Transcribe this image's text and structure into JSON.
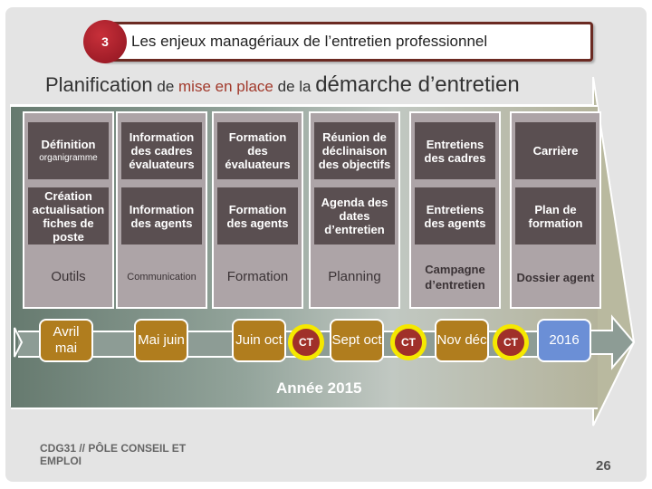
{
  "header": {
    "section_number": "3",
    "section_title": "Les enjeux managériaux de l’entretien professionnel"
  },
  "title": {
    "part1": "Planification",
    "part2": " de ",
    "part3": "mise en place",
    "part4": " de la ",
    "part5": "démarche d’entretien"
  },
  "columns": [
    {
      "cell1_main": "Définition",
      "cell1_sub": "organigramme",
      "cell2": "Création actualisation fiches de poste",
      "footer": "Outils"
    },
    {
      "cell1_main": "Information des cadres évaluateurs",
      "cell1_sub": "",
      "cell2": "Information des agents",
      "footer": "Communication"
    },
    {
      "cell1_main": "Formation des évaluateurs",
      "cell1_sub": "",
      "cell2": "Formation des agents",
      "footer": "Formation"
    },
    {
      "cell1_main": "Réunion de déclinaison des objectifs",
      "cell1_sub": "",
      "cell2": "Agenda des dates d’entretien",
      "footer": "Planning"
    },
    {
      "cell1_main": "Entretiens des cadres",
      "cell1_sub": "",
      "cell2": "Entretiens des agents",
      "footer": "Campagne d’entretien"
    },
    {
      "cell1_main": "Carrière",
      "cell1_sub": "",
      "cell2": "Plan de formation",
      "footer": "Dossier agent"
    }
  ],
  "timeline": {
    "periods": [
      "Avril mai",
      "Mai juin",
      "Juin oct",
      "Sept oct",
      "Nov déc",
      "2016"
    ],
    "milestone_label": "CT",
    "year_label": "Année 2015"
  },
  "colors": {
    "period": "#b07d1e",
    "next_year": "#6b8fd6",
    "milestone": "#a0302a",
    "milestone_ring": "#f5e800",
    "accent_red": "#a23a2c"
  },
  "footer": {
    "organization": "CDG31 // PÔLE CONSEIL ET EMPLOI",
    "page_number": "26"
  }
}
